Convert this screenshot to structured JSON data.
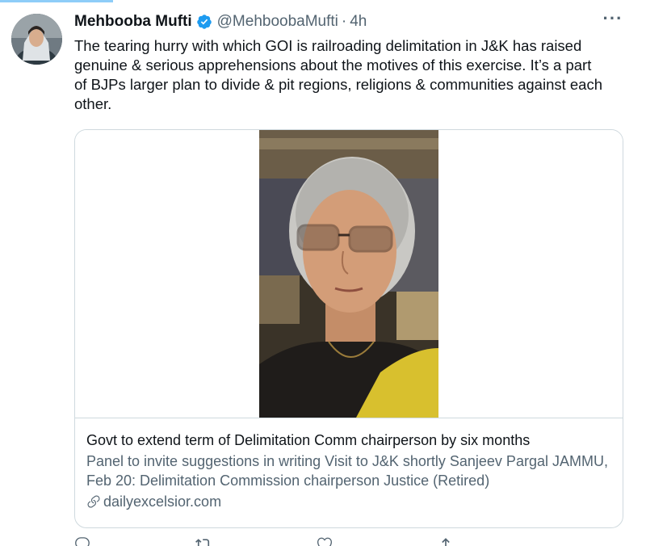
{
  "tweet": {
    "author_name": "Mehbooba Mufti",
    "handle": "@MehboobaMufti",
    "separator": "·",
    "time": "4h",
    "more_label": "···",
    "text": "The tearing hurry with which GOI is railroading delimitation in J&K has raised genuine & serious apprehensions about the motives of this exercise. It’s a part of BJPs larger plan to divide & pit regions, religions & communities against each other.",
    "verified_icon": "verified-badge-icon"
  },
  "card": {
    "title": "Govt to extend term of Delimitation Comm chairperson by six months",
    "description": "Panel to invite suggestions in writing Visit to J&K shortly Sanjeev Pargal JAMMU, Feb 20: Delimitation Commission chairperson Justice (Retired)",
    "domain": "dailyexcelsior.com",
    "link_icon": "link-icon",
    "image": "woman-with-glasses-portrait"
  },
  "actions": [
    {
      "icon": "reply-icon"
    },
    {
      "icon": "retweet-icon"
    },
    {
      "icon": "like-icon"
    },
    {
      "icon": "share-icon"
    }
  ],
  "colors": {
    "verified": "#1d9bf0",
    "secondary_text": "#536471",
    "border": "#cfd9de"
  }
}
